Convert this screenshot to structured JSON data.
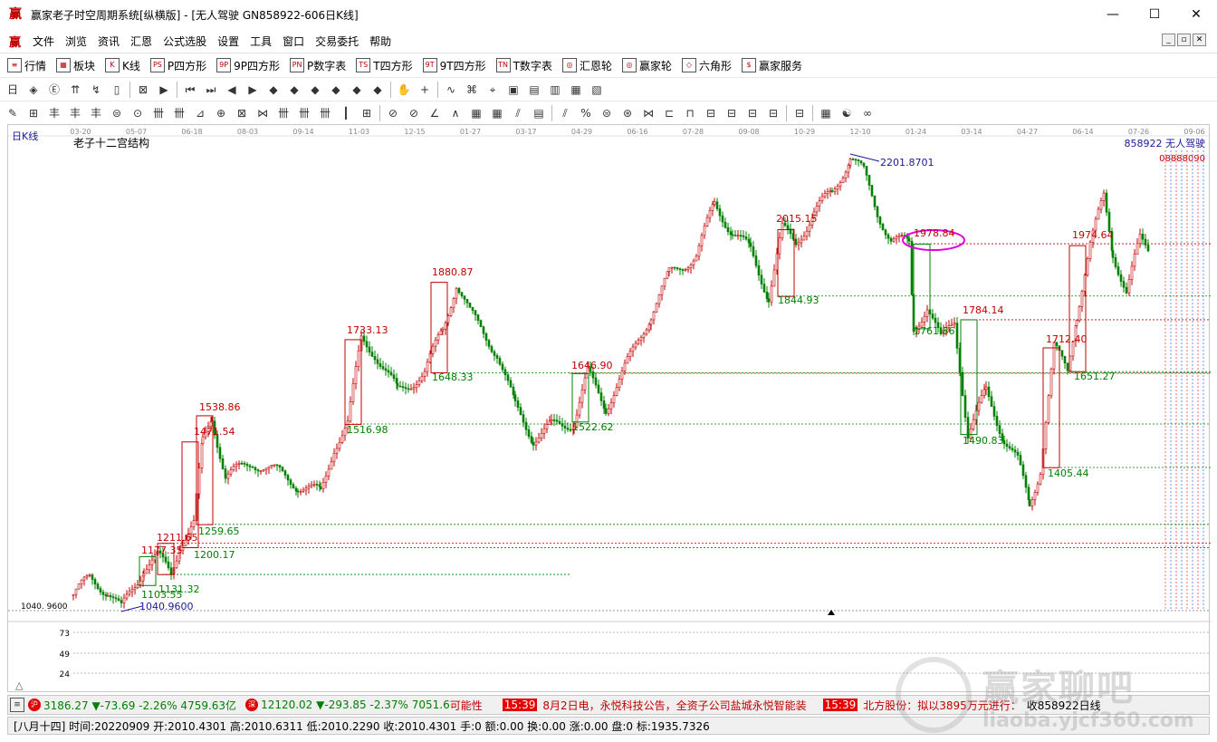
{
  "window": {
    "title": "赢家老子时空周期系统[纵横版] - [无人驾驶  GN858922-606日K线]",
    "app_icon": "赢",
    "minimize": "—",
    "maximize": "☐",
    "close": "✕"
  },
  "menu": {
    "logo": "赢",
    "items": [
      "文件",
      "浏览",
      "资讯",
      "汇恩",
      "公式选股",
      "设置",
      "工具",
      "窗口",
      "交易委托",
      "帮助"
    ],
    "mdi": [
      "_",
      "▫",
      "✕"
    ]
  },
  "toolbar1": {
    "items": [
      {
        "icon": "≡",
        "label": "行情"
      },
      {
        "icon": "▦",
        "label": "板块"
      },
      {
        "icon": "K",
        "label": "K线"
      },
      {
        "icon": "PS",
        "label": "P四方形"
      },
      {
        "icon": "9P",
        "label": "9P四方形"
      },
      {
        "icon": "PN",
        "label": "P数字表"
      },
      {
        "icon": "TS",
        "label": "T四方形"
      },
      {
        "icon": "9T",
        "label": "9T四方形"
      },
      {
        "icon": "TN",
        "label": "T数字表"
      },
      {
        "icon": "◎",
        "label": "汇恩轮"
      },
      {
        "icon": "◎",
        "label": "赢家轮"
      },
      {
        "icon": "◇",
        "label": "六角形"
      },
      {
        "icon": "$",
        "label": "赢家服务"
      }
    ]
  },
  "toolbar2": {
    "icons": [
      "日",
      "◈",
      "Ⓔ",
      "⇈",
      "↯",
      "▯",
      "⊠",
      "▶",
      "⏮",
      "⏭",
      "◀",
      "▶",
      "◆",
      "◆",
      "◆",
      "◆",
      "◆",
      "◆",
      "✋",
      "+",
      "∿",
      "⌘",
      "⌖",
      "▣",
      "▤",
      "▥",
      "▦",
      "▧"
    ]
  },
  "toolbar3": {
    "icons": [
      "✎",
      "⊞",
      "丰",
      "丰",
      "丰",
      "⊜",
      "⊙",
      "卌",
      "卌",
      "⊿",
      "⊕",
      "⊠",
      "⋈",
      "卌",
      "卌",
      "卌",
      "┃",
      "⊞",
      "⊘",
      "⊘",
      "∠",
      "∧",
      "▦",
      "▦",
      "⫽",
      "▤",
      "⫽",
      "%",
      "⊜",
      "⊛",
      "⋈",
      "⊏",
      "⊓",
      "⊟",
      "⊟",
      "⊟",
      "⊟",
      "⊟",
      "▦",
      "☯",
      "∞"
    ]
  },
  "chart": {
    "period_label": "日K线",
    "indicator_title": "老子十二宫结构",
    "stock_label": "858922  无人驾驶",
    "price_axis_low": "1040. 9600",
    "sub_ticks": [
      "73",
      "49",
      "24"
    ],
    "date_ticks": [
      "03-20",
      "05-07",
      "06-18",
      "08-03",
      "09-14",
      "11-03",
      "12-15",
      "01-27",
      "03-17",
      "04-29",
      "06-16",
      "07-28",
      "09-08",
      "10-29",
      "12-10",
      "01-24",
      "03-14",
      "04-27",
      "06-14",
      "07-26",
      "09-06"
    ],
    "right_codes": "08888090",
    "annotations": [
      {
        "text": "2201.8701",
        "color": "#1a1a9a"
      },
      {
        "text": "2015.15",
        "color": "#c00000"
      },
      {
        "text": "1978.84",
        "color": "#c00000"
      },
      {
        "text": "1974.64",
        "color": "#c00000"
      },
      {
        "text": "1880.87",
        "color": "#c00000"
      },
      {
        "text": "1844.93",
        "color": "#008000"
      },
      {
        "text": "1784.14",
        "color": "#c00000"
      },
      {
        "text": "1761.86",
        "color": "#008000"
      },
      {
        "text": "1733.13",
        "color": "#c00000"
      },
      {
        "text": "1712.40",
        "color": "#c00000"
      },
      {
        "text": "1648.33",
        "color": "#008000"
      },
      {
        "text": "1646.90",
        "color": "#c00000"
      },
      {
        "text": "1651.27",
        "color": "#008000"
      },
      {
        "text": "1538.86",
        "color": "#c00000"
      },
      {
        "text": "1522.62",
        "color": "#008000"
      },
      {
        "text": "1516.98",
        "color": "#008000"
      },
      {
        "text": "1490.83",
        "color": "#008000"
      },
      {
        "text": "1471.54",
        "color": "#c00000"
      },
      {
        "text": "1405.44",
        "color": "#008000"
      },
      {
        "text": "1259.65",
        "color": "#008000"
      },
      {
        "text": "1211.65",
        "color": "#c00000"
      },
      {
        "text": "1200.17",
        "color": "#008000"
      },
      {
        "text": "1177.35",
        "color": "#c00000"
      },
      {
        "text": "1131.32",
        "color": "#008000"
      },
      {
        "text": "1103.55",
        "color": "#008000"
      },
      {
        "text": "1040.9600",
        "color": "#1a1a9a"
      }
    ],
    "colors": {
      "up": "#c00000",
      "down": "#008000",
      "highlight": "#e000e0",
      "blue": "#1a1a9a"
    },
    "scroll_btn": "△"
  },
  "status1": {
    "sh_icon": "沪",
    "sh_text": "3186.27 ▼-73.69 -2.26% 4759.63亿",
    "sz_icon": "深",
    "sz_text": "12120.02 ▼-293.85 -2.37% 7051.6",
    "news_pre": "可能性",
    "news1_time": "15:39",
    "news1_text": "8月2日电，永悦科技公告，全资子公司盐城永悦智能装",
    "news2_time": "15:39",
    "news2_text": "北方股份：拟以3895万元进行：",
    "right": "收858922日线"
  },
  "status2": {
    "text": "[八月十四] 时间:20220909 开:2010.4301 高:2010.6311 低:2010.2290 收:2010.4301 手:0 额:0.00 换:0.00 涨:0.00 盘:0 标:1935.7326"
  },
  "watermark": {
    "big": "赢家聊吧",
    "small": "liaoba.yjcf360.com"
  }
}
